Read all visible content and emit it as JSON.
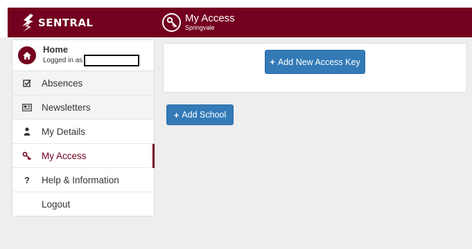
{
  "app": {
    "brand": "SENTRAL"
  },
  "header": {
    "title": "My Access",
    "subtitle": "Springvale",
    "icon": "key-icon"
  },
  "sidebar": {
    "home": {
      "title": "Home",
      "logged_in_prefix": "Logged in as",
      "icon": "home-icon"
    },
    "items": [
      {
        "label": "Absences",
        "icon": "checkbox-icon"
      },
      {
        "label": "Newsletters",
        "icon": "newspaper-icon"
      },
      {
        "label": "My Details",
        "icon": "user-icon"
      },
      {
        "label": "My Access",
        "icon": "key-icon",
        "active": true
      },
      {
        "label": "Help & Information",
        "icon": "question-icon"
      },
      {
        "label": "Logout",
        "icon": ""
      }
    ]
  },
  "main": {
    "add_key_label": "Add New Access Key",
    "add_school_label": "Add School",
    "plus_symbol": "+"
  },
  "colors": {
    "brand": "#74001f",
    "button": "#337ab7",
    "background": "#eeeeee"
  }
}
